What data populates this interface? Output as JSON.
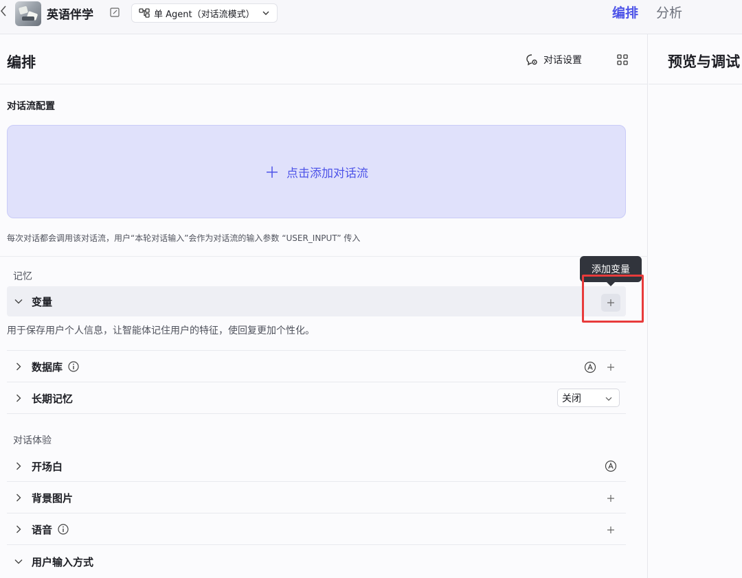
{
  "topbar": {
    "app_name": "英语伴学",
    "mode_label": "单 Agent（对话流模式）",
    "tabs": [
      {
        "label": "编排",
        "active": true
      },
      {
        "label": "分析",
        "active": false
      }
    ],
    "accent_color": "#4d53e8"
  },
  "left_panel": {
    "title": "编排",
    "dialog_settings_label": "对话设置",
    "flow_config_label": "对话流配置",
    "add_flow_label": "点击添加对话流",
    "hint": "每次对话都会调用该对话流，用户“本轮对话输入”会作为对话流的输入参数 “USER_INPUT” 传入",
    "memory_group": {
      "label": "记忆",
      "variable_row": {
        "label": "变量",
        "expanded": true,
        "description": "用于保存用户个人信息，让智能体记住用户的特征，使回复更加个性化。"
      },
      "database_row": {
        "label": "数据库",
        "expanded": false
      },
      "long_term_memory_row": {
        "label": "长期记忆",
        "expanded": false,
        "select_value": "关闭"
      }
    },
    "experience_group": {
      "label": "对话体验",
      "rows": [
        {
          "label": "开场白",
          "expanded": false
        },
        {
          "label": "背景图片",
          "expanded": false
        },
        {
          "label": "语音",
          "expanded": false
        },
        {
          "label": "用户输入方式",
          "expanded": true
        }
      ]
    },
    "tooltip": "添加变量",
    "highlight_color": "#e83b3b"
  },
  "right_panel": {
    "title": "预览与调试"
  }
}
